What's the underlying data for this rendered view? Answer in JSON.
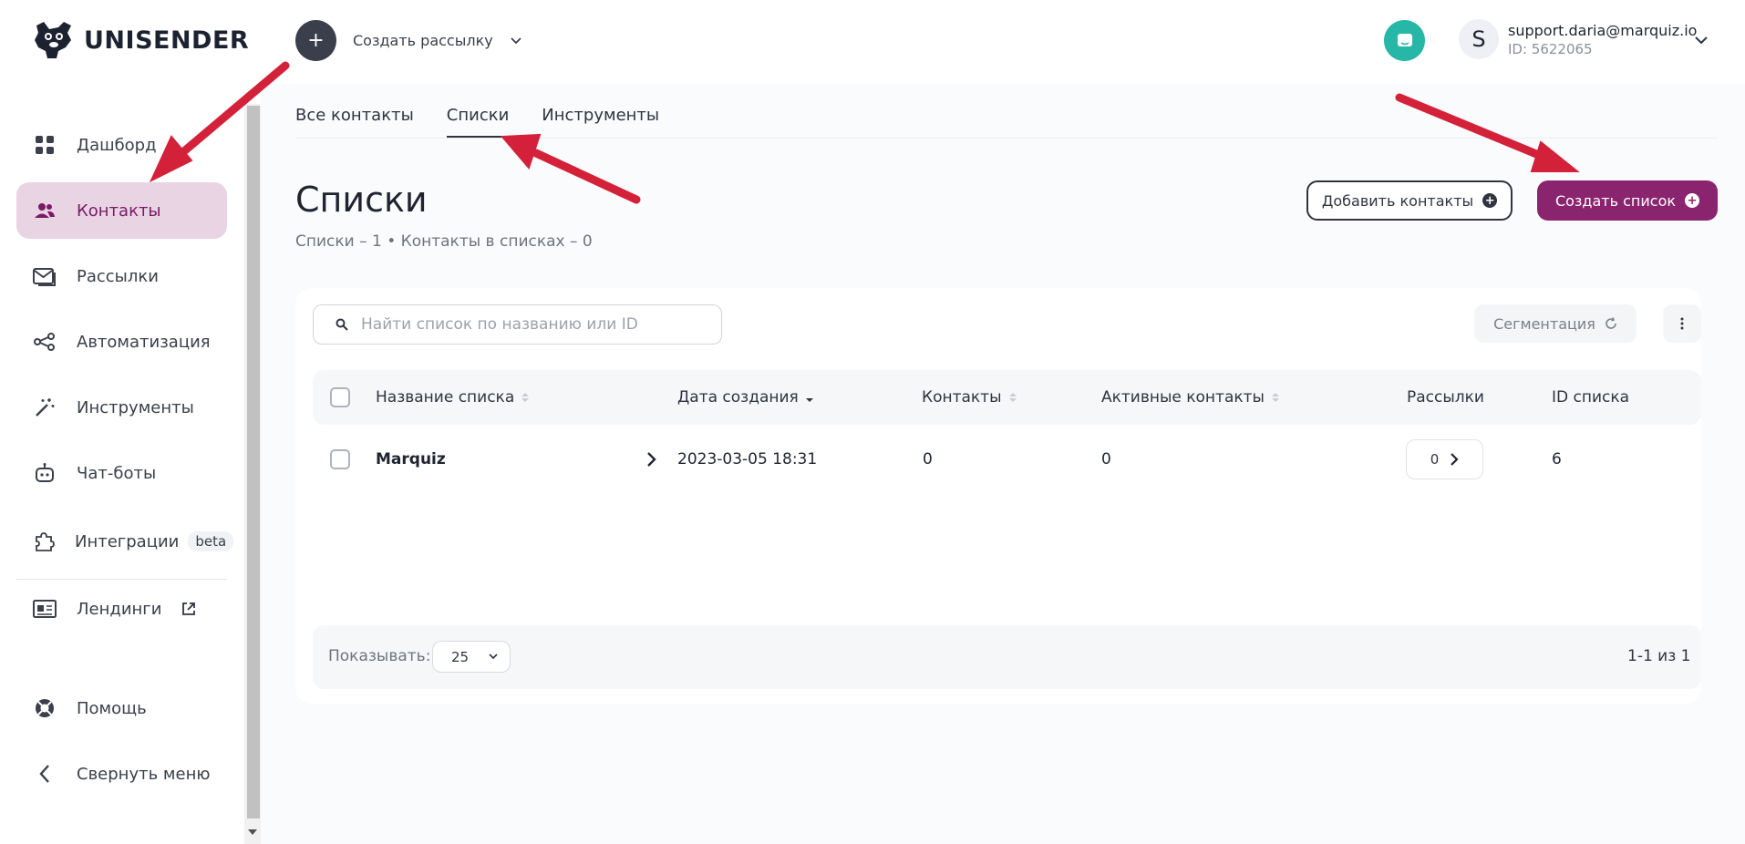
{
  "header": {
    "logo_text": "UNISENDER",
    "create_campaign_label": "Создать рассылку",
    "account": {
      "avatar_letter": "S",
      "email": "support.daria@marquiz.io",
      "id_text": "ID: 5622065"
    }
  },
  "sidebar": {
    "items": [
      {
        "label": "Дашборд",
        "icon": "dashboard-icon"
      },
      {
        "label": "Контакты",
        "icon": "contacts-icon",
        "active": true
      },
      {
        "label": "Рассылки",
        "icon": "mail-icon"
      },
      {
        "label": "Автоматизация",
        "icon": "automation-icon"
      },
      {
        "label": "Инструменты",
        "icon": "magic-wand-icon"
      },
      {
        "label": "Чат-боты",
        "icon": "robot-icon"
      },
      {
        "label": "Интеграции",
        "icon": "puzzle-icon",
        "badge": "beta"
      },
      {
        "label": "Лендинги",
        "icon": "landing-icon"
      }
    ],
    "help_label": "Помощь",
    "collapse_label": "Свернуть меню"
  },
  "tabs": [
    "Все контакты",
    "Списки",
    "Инструменты"
  ],
  "page": {
    "title": "Списки",
    "subtitle": "Списки – 1 • Контакты в списках – 0",
    "add_contacts_label": "Добавить контакты",
    "create_list_label": "Создать список"
  },
  "toolbar": {
    "search_placeholder": "Найти список по названию или ID",
    "segmentation_label": "Сегментация"
  },
  "table": {
    "columns": [
      "Название списка",
      "Дата создания",
      "Контакты",
      "Активные контакты",
      "Рассылки",
      "ID списка"
    ],
    "rows": [
      {
        "name": "Marquiz",
        "created": "2023-03-05 18:31",
        "contacts": "0",
        "active_contacts": "0",
        "campaigns": "0",
        "id": "6"
      }
    ]
  },
  "footer": {
    "show_label": "Показывать:",
    "per_page": "25",
    "pagination": "1-1 из 1"
  },
  "colors": {
    "accent": "#8a246f",
    "active_nav_bg": "#e9d4e4",
    "chat_button": "#26b7a6",
    "annotation_arrow": "#d4213a"
  }
}
